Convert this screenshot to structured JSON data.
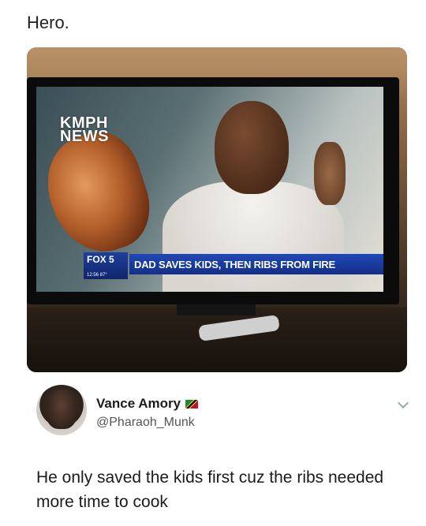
{
  "caption": "Hero.",
  "photo": {
    "channel_logo_line1": "KMPH",
    "channel_logo_line2": "NEWS",
    "ticker_brand": "FOX 5",
    "ticker_time": "12:56 87°",
    "headline": "DAD SAVES KIDS, THEN RIBS FROM FIRE"
  },
  "tweet": {
    "display_name": "Vance Amory",
    "handle": "@Pharaoh_Munk",
    "text": "He only saved the kids first cuz the ribs needed more time to cook",
    "flag_icon": "flag-icon",
    "more_icon": "chevron-down-icon"
  },
  "colors": {
    "ticker_blue": "#1f48b8",
    "text": "#1b1b1b",
    "handle_gray": "#555555"
  }
}
